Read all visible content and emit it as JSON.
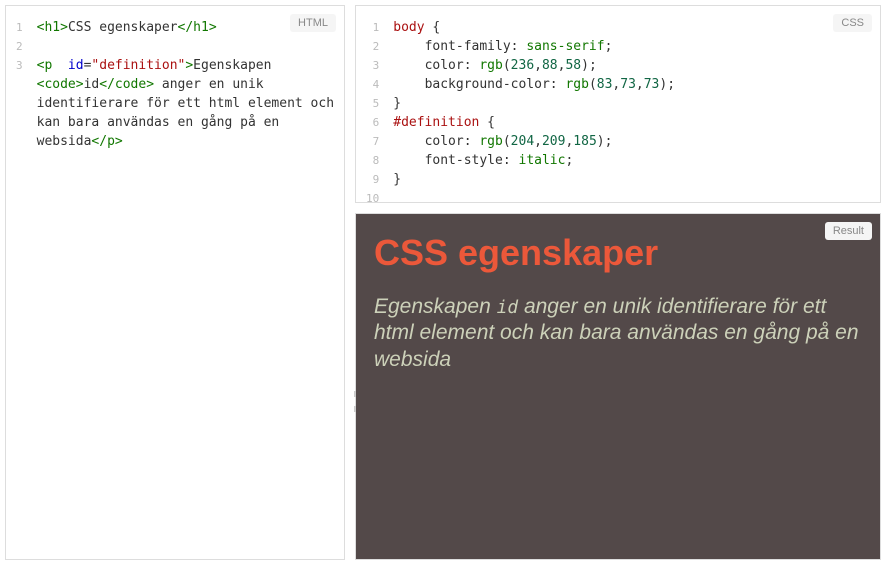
{
  "panes": {
    "html": {
      "badge": "HTML"
    },
    "css": {
      "badge": "CSS"
    },
    "result": {
      "badge": "Result"
    }
  },
  "html_editor": {
    "gutter": [
      "1",
      "2",
      "3"
    ],
    "tokens": {
      "t01": "<h1>",
      "t02": "CSS egenskaper",
      "t03": "</h1>",
      "t04": "<p ",
      "t05": " id",
      "t06": "=",
      "t07": "\"definition\"",
      "t08": ">",
      "t09": "Egenskapen ",
      "t10": "<code>",
      "t11": "id",
      "t12": "</code>",
      "t13": " anger en unik identifierare för ett html element och kan bara användas en gång på en websida",
      "t14": "</p>"
    }
  },
  "css_editor": {
    "gutter": [
      "1",
      "2",
      "3",
      "4",
      "5",
      "6",
      "7",
      "8",
      "9",
      "10"
    ],
    "tokens": {
      "c01": "body",
      "c02": " {",
      "c03": "font-family",
      "c04": ": ",
      "c05": "sans-serif",
      "c06": ";",
      "c07": "color",
      "c08": ": ",
      "c09": "rgb",
      "c10": "(",
      "c11": "236",
      "c12": ",",
      "c13": "88",
      "c14": ",",
      "c15": "58",
      "c16": ")",
      "c17": ";",
      "c18": "background-color",
      "c19": ": ",
      "c20": "rgb",
      "c21": "(",
      "c22": "83",
      "c23": ",",
      "c24": "73",
      "c25": ",",
      "c26": "73",
      "c27": ")",
      "c28": ";",
      "c29": "}",
      "c30": "#definition",
      "c31": " {",
      "c32": "color",
      "c33": ": ",
      "c34": "rgb",
      "c35": "(",
      "c36": "204",
      "c37": ",",
      "c38": "209",
      "c39": ",",
      "c40": "185",
      "c41": ")",
      "c42": ";",
      "c43": "font-style",
      "c44": ": ",
      "c45": "italic",
      "c46": ";",
      "c47": "}"
    }
  },
  "result": {
    "h1": "CSS egenskaper",
    "p_part1": "Egenskapen ",
    "p_code": "id",
    "p_part2": " anger en unik identifierare för ett html element och kan bara användas en gång på en websida"
  }
}
